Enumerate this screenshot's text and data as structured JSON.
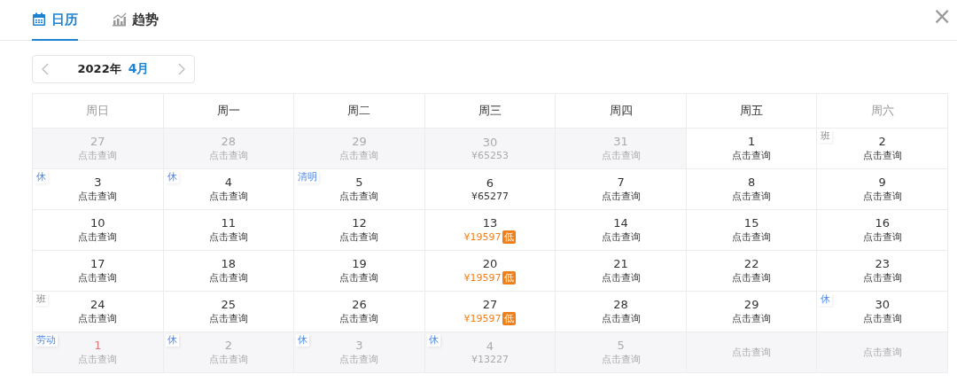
{
  "tabs": [
    {
      "label": "日历",
      "selected": true
    },
    {
      "label": "趋势",
      "selected": false
    }
  ],
  "close": "×",
  "month_nav": {
    "year": "2022年",
    "month": "4月"
  },
  "weekdays": [
    {
      "label": "周日",
      "weekend": true
    },
    {
      "label": "周一",
      "weekend": false
    },
    {
      "label": "周二",
      "weekend": false
    },
    {
      "label": "周三",
      "weekend": false
    },
    {
      "label": "周四",
      "weekend": false
    },
    {
      "label": "周五",
      "weekend": false
    },
    {
      "label": "周六",
      "weekend": true
    }
  ],
  "weeks": [
    {
      "cells": [
        {
          "day": "27",
          "note": "点击查询",
          "kind": "query",
          "outside": true,
          "holiday": false
        },
        {
          "day": "28",
          "note": "点击查询",
          "kind": "query",
          "outside": true,
          "holiday": false
        },
        {
          "day": "29",
          "note": "点击查询",
          "kind": "query",
          "outside": true,
          "holiday": false
        },
        {
          "day": "30",
          "note": "¥65253",
          "kind": "price",
          "outside": true,
          "holiday": false
        },
        {
          "day": "31",
          "note": "点击查询",
          "kind": "query",
          "outside": true,
          "holiday": false
        },
        {
          "day": "1",
          "note": "点击查询",
          "kind": "query",
          "outside": false,
          "holiday": false
        },
        {
          "day": "2",
          "note": "点击查询",
          "kind": "query",
          "outside": false,
          "holiday": false,
          "tag": {
            "text": "班",
            "kind": "work"
          }
        }
      ]
    },
    {
      "cells": [
        {
          "day": "3",
          "note": "点击查询",
          "kind": "query",
          "outside": false,
          "holiday": false,
          "tag": {
            "text": "休",
            "kind": "rest"
          }
        },
        {
          "day": "4",
          "note": "点击查询",
          "kind": "query",
          "outside": false,
          "holiday": false,
          "tag": {
            "text": "休",
            "kind": "rest"
          }
        },
        {
          "day": "5",
          "note": "点击查询",
          "kind": "query",
          "outside": false,
          "holiday": false,
          "tag": {
            "text": "清明",
            "kind": "rest"
          }
        },
        {
          "day": "6",
          "note": "¥65277",
          "kind": "price",
          "outside": false,
          "holiday": false
        },
        {
          "day": "7",
          "note": "点击查询",
          "kind": "query",
          "outside": false,
          "holiday": false
        },
        {
          "day": "8",
          "note": "点击查询",
          "kind": "query",
          "outside": false,
          "holiday": false
        },
        {
          "day": "9",
          "note": "点击查询",
          "kind": "query",
          "outside": false,
          "holiday": false
        }
      ]
    },
    {
      "cells": [
        {
          "day": "10",
          "note": "点击查询",
          "kind": "query",
          "outside": false,
          "holiday": false
        },
        {
          "day": "11",
          "note": "点击查询",
          "kind": "query",
          "outside": false,
          "holiday": false
        },
        {
          "day": "12",
          "note": "点击查询",
          "kind": "query",
          "outside": false,
          "holiday": false
        },
        {
          "day": "13",
          "note": "¥19597",
          "kind": "low",
          "badge": "低",
          "outside": false,
          "holiday": false
        },
        {
          "day": "14",
          "note": "点击查询",
          "kind": "query",
          "outside": false,
          "holiday": false
        },
        {
          "day": "15",
          "note": "点击查询",
          "kind": "query",
          "outside": false,
          "holiday": false
        },
        {
          "day": "16",
          "note": "点击查询",
          "kind": "query",
          "outside": false,
          "holiday": false
        }
      ]
    },
    {
      "cells": [
        {
          "day": "17",
          "note": "点击查询",
          "kind": "query",
          "outside": false,
          "holiday": false
        },
        {
          "day": "18",
          "note": "点击查询",
          "kind": "query",
          "outside": false,
          "holiday": false
        },
        {
          "day": "19",
          "note": "点击查询",
          "kind": "query",
          "outside": false,
          "holiday": false
        },
        {
          "day": "20",
          "note": "¥19597",
          "kind": "low",
          "badge": "低",
          "outside": false,
          "holiday": false
        },
        {
          "day": "21",
          "note": "点击查询",
          "kind": "query",
          "outside": false,
          "holiday": false
        },
        {
          "day": "22",
          "note": "点击查询",
          "kind": "query",
          "outside": false,
          "holiday": false
        },
        {
          "day": "23",
          "note": "点击查询",
          "kind": "query",
          "outside": false,
          "holiday": false
        }
      ]
    },
    {
      "cells": [
        {
          "day": "24",
          "note": "点击查询",
          "kind": "query",
          "outside": false,
          "holiday": false,
          "tag": {
            "text": "班",
            "kind": "work"
          }
        },
        {
          "day": "25",
          "note": "点击查询",
          "kind": "query",
          "outside": false,
          "holiday": false
        },
        {
          "day": "26",
          "note": "点击查询",
          "kind": "query",
          "outside": false,
          "holiday": false
        },
        {
          "day": "27",
          "note": "¥19597",
          "kind": "low",
          "badge": "低",
          "outside": false,
          "holiday": false
        },
        {
          "day": "28",
          "note": "点击查询",
          "kind": "query",
          "outside": false,
          "holiday": false
        },
        {
          "day": "29",
          "note": "点击查询",
          "kind": "query",
          "outside": false,
          "holiday": false
        },
        {
          "day": "30",
          "note": "点击查询",
          "kind": "query",
          "outside": false,
          "holiday": false,
          "tag": {
            "text": "休",
            "kind": "rest"
          }
        }
      ]
    },
    {
      "cells": [
        {
          "day": "1",
          "note": "点击查询",
          "kind": "query",
          "outside": true,
          "holiday": true,
          "tag": {
            "text": "劳动",
            "kind": "rest"
          }
        },
        {
          "day": "2",
          "note": "点击查询",
          "kind": "query",
          "outside": true,
          "holiday": false,
          "tag": {
            "text": "休",
            "kind": "rest"
          }
        },
        {
          "day": "3",
          "note": "点击查询",
          "kind": "query",
          "outside": true,
          "holiday": false,
          "tag": {
            "text": "休",
            "kind": "rest"
          }
        },
        {
          "day": "4",
          "note": "¥13227",
          "kind": "price",
          "outside": true,
          "holiday": false,
          "tag": {
            "text": "休",
            "kind": "rest"
          }
        },
        {
          "day": "5",
          "note": "点击查询",
          "kind": "query",
          "outside": true,
          "holiday": false
        },
        {
          "note": "点击查询",
          "kind": "query",
          "outside": true
        },
        {
          "note": "点击查询",
          "kind": "query",
          "outside": true
        }
      ]
    }
  ]
}
